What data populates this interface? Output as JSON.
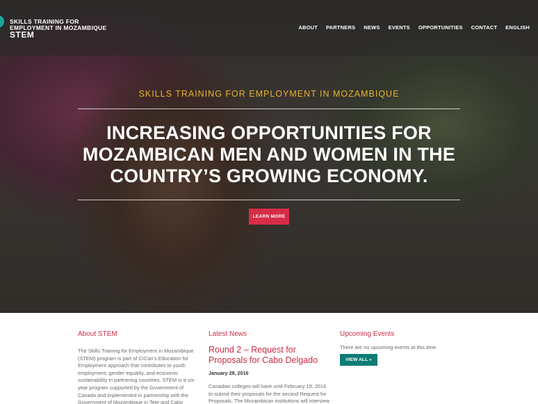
{
  "header": {
    "logo_line1": "SKILLS TRAINING FOR",
    "logo_line2": "EMPLOYMENT IN MOZAMBIQUE",
    "logo_acronym": "STEM",
    "nav": [
      "ABOUT",
      "PARTNERS",
      "NEWS",
      "EVENTS",
      "OPPORTUNITIES",
      "CONTACT",
      "ENGLISH"
    ]
  },
  "hero": {
    "kicker": "SKILLS TRAINING FOR EMPLOYMENT IN MOZAMBIQUE",
    "title": "INCREASING OPPORTUNITIES FOR MOZAMBICAN MEN AND WOMEN IN THE COUNTRY’S GROWING ECONOMY.",
    "button": "LEARN MORE"
  },
  "about": {
    "title": "About STEM",
    "text": "The Skills Training for Employment in Mozambique (STEM) program  is part of CICan's Education for Employment approach that contributes to youth employment, gender equality, and economic sustainability in partnering countries. STEM is a six-year program supported by the Government of Canada and implemented in partnership with the Government of Mozambique in Tete and Cabo"
  },
  "news": {
    "title": "Latest News",
    "item_title": "Round 2 – Request for Proposals for Cabo Delgado",
    "item_date": "January 28, 2016",
    "item_text": "Canadian colleges will have until February 19, 2016 to submit their proposals for the second Request for Proposals. The Mozambican institutions will interview"
  },
  "events": {
    "title": "Upcoming Events",
    "empty": "There are no upcoming events at this time.",
    "button": "VIEW ALL »"
  },
  "colors": {
    "accent_red": "#cc2a43",
    "kicker_gold": "#e4b331",
    "teal": "#0d7c73"
  }
}
